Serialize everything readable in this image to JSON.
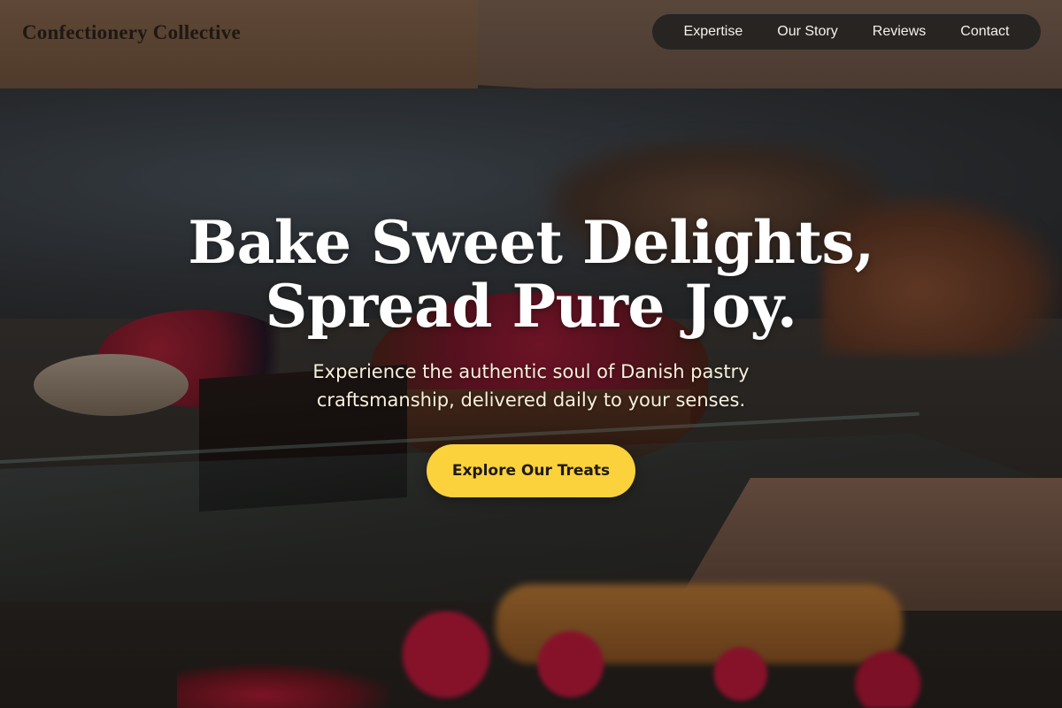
{
  "brand": {
    "name": "Confectionery Collective"
  },
  "nav": {
    "items": [
      {
        "label": "Expertise"
      },
      {
        "label": "Our Story"
      },
      {
        "label": "Reviews"
      },
      {
        "label": "Contact"
      }
    ]
  },
  "hero": {
    "title_line1": "Bake Sweet Delights,",
    "title_line2": "Spread Pure Joy.",
    "subtitle_line1": "Experience the authentic soul of Danish pastry",
    "subtitle_line2": "craftsmanship, delivered daily to your senses.",
    "cta_label": "Explore Our Treats"
  },
  "colors": {
    "accent": "#fbd23c",
    "nav_background": "#222020",
    "hero_text": "#ffffff"
  }
}
